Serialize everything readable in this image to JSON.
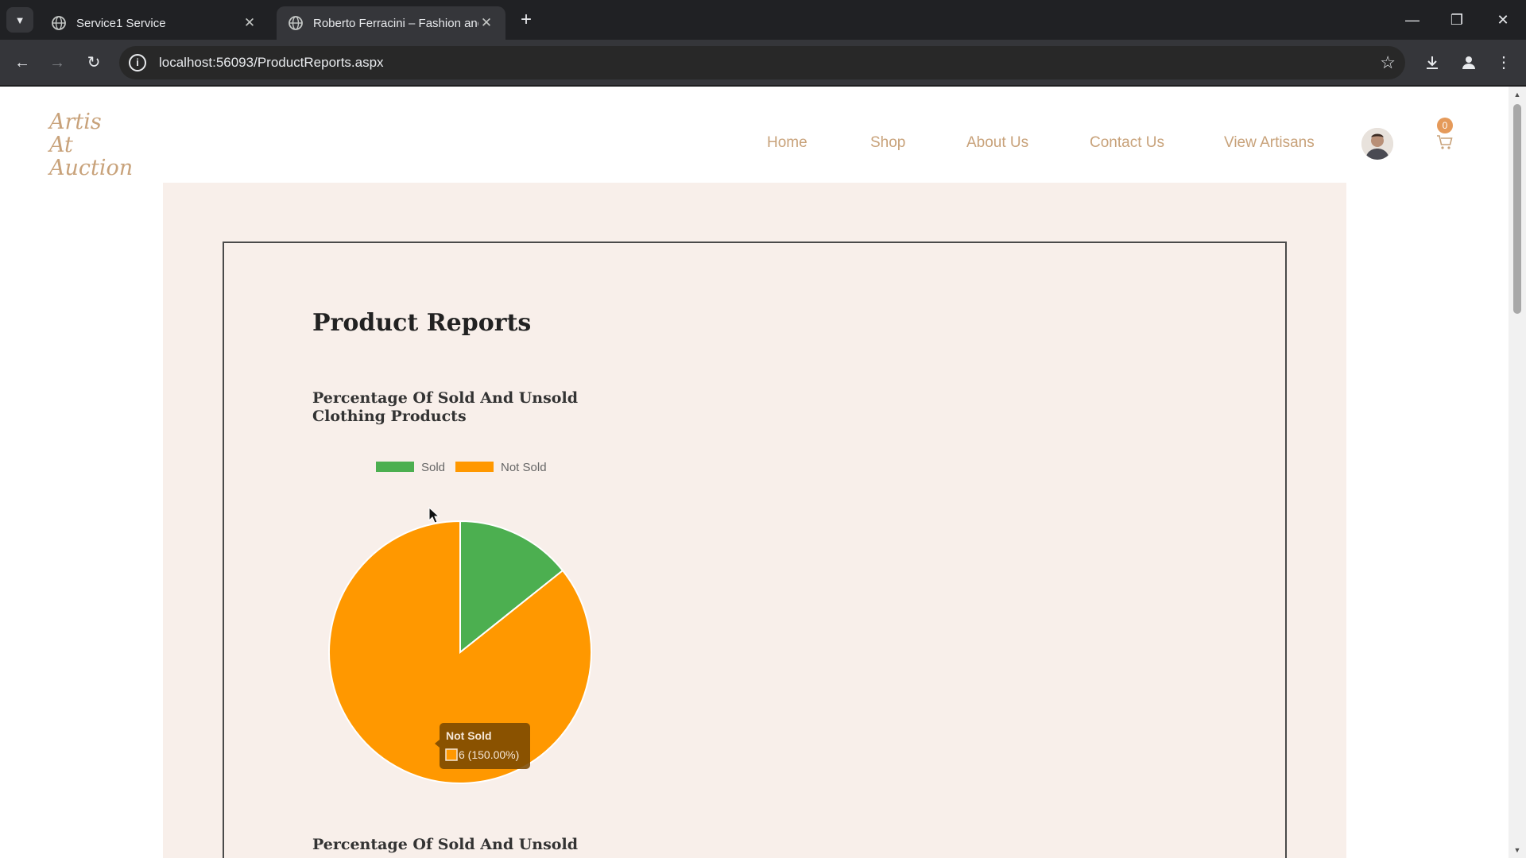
{
  "browser": {
    "tabs": [
      {
        "title": "Service1 Service",
        "active": false
      },
      {
        "title": "Roberto Ferracini – Fashion and",
        "active": true
      }
    ],
    "url": "localhost:56093/ProductReports.aspx"
  },
  "site": {
    "logo_lines": [
      "Artis",
      "At",
      "Auction"
    ],
    "nav": [
      "Home",
      "Shop",
      "About Us",
      "Contact Us",
      "View Artisans"
    ],
    "cart_count": "0"
  },
  "page": {
    "title": "Product Reports",
    "chart1_title": "Percentage Of Sold And Unsold Clothing Products",
    "chart2_title": "Percentage Of Sold And Unsold"
  },
  "chart_data": {
    "type": "pie",
    "categories": [
      "Sold",
      "Not Sold"
    ],
    "values": [
      1,
      6
    ],
    "colors": [
      "#4caf50",
      "#ff9800"
    ],
    "legend_position": "top",
    "tooltip": {
      "title": "Not Sold",
      "label": "6 (150.00%)"
    }
  }
}
